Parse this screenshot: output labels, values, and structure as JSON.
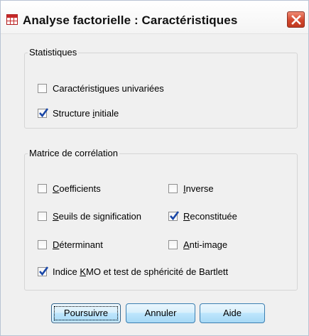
{
  "window": {
    "title": "Analyse factorielle : Caractéristiques",
    "close_icon": "close-icon"
  },
  "statistics": {
    "legend": "Statistiques",
    "options": [
      {
        "label_pre": "Caractéristi",
        "label_u": "q",
        "label_post": "ues univariées",
        "checked": false
      },
      {
        "label_pre": "Structure ",
        "label_u": "i",
        "label_post": "nitiale",
        "checked": true
      }
    ]
  },
  "correlation": {
    "legend": "Matrice de corrélation",
    "options": [
      {
        "label_pre": "",
        "label_u": "C",
        "label_post": "oefficients",
        "checked": false
      },
      {
        "label_pre": "",
        "label_u": "I",
        "label_post": "nverse",
        "checked": false
      },
      {
        "label_pre": "",
        "label_u": "S",
        "label_post": "euils de signification",
        "checked": false
      },
      {
        "label_pre": "",
        "label_u": "R",
        "label_post": "econstituée",
        "checked": true
      },
      {
        "label_pre": "",
        "label_u": "D",
        "label_post": "éterminant",
        "checked": false
      },
      {
        "label_pre": "",
        "label_u": "A",
        "label_post": "nti-image",
        "checked": false
      },
      {
        "label_pre": "Indice ",
        "label_u": "K",
        "label_post": "MO et test de sphéricité de Bartlett",
        "checked": true
      }
    ]
  },
  "buttons": {
    "continue": "Poursuivre",
    "cancel": "Annuler",
    "help": "Aide"
  },
  "colors": {
    "accent": "#1a47a7",
    "close": "#d2472d"
  }
}
